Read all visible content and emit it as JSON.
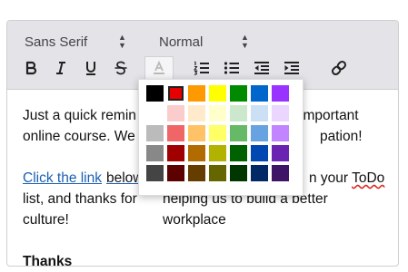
{
  "toolbar": {
    "font_value": "Sans Serif",
    "size_value": "Normal",
    "caret_up": "▲",
    "caret_down": "▼",
    "color_button_glyph": "A"
  },
  "icons": {
    "bold": "bold-icon",
    "italic": "italic-icon",
    "underline": "underline-icon",
    "strike": "strikethrough-icon",
    "text_color": "text-color-icon",
    "ordered_list": "ordered-list-icon",
    "bullet_list": "bullet-list-icon",
    "outdent": "outdent-icon",
    "indent": "indent-icon",
    "link": "link-icon"
  },
  "content": {
    "p1_a": "Just a quick remin",
    "p1_b": " important",
    "p1_c": "online course. We",
    "p1_d": "pation!",
    "p2_link": "Click the link",
    "p2_a": " below",
    "p2_b": "n your ",
    "p2_todo": "ToDo",
    "p2_c": "list, and thanks for",
    "p2_d": "helping us to build a better workplace",
    "p2_e": "culture!",
    "p3": "Thanks"
  },
  "palette": {
    "rows": [
      [
        "#000000",
        "#e60000",
        "#ff9900",
        "#ffff00",
        "#008a00",
        "#0066cc",
        "#9933ff"
      ],
      [
        "#ffffff",
        "#facccc",
        "#ffebcc",
        "#ffffcc",
        "#cce8cc",
        "#cce0f5",
        "#ebd6ff"
      ],
      [
        "#bbbbbb",
        "#f06666",
        "#ffc266",
        "#ffff66",
        "#66b966",
        "#66a3e0",
        "#c285ff"
      ],
      [
        "#888888",
        "#a10000",
        "#b26b00",
        "#b2b200",
        "#006100",
        "#0047b2",
        "#6b24b2"
      ],
      [
        "#444444",
        "#5c0000",
        "#663d00",
        "#666600",
        "#003700",
        "#002966",
        "#3d1466"
      ]
    ],
    "selected": "#e60000"
  },
  "colors": {
    "toolbar_bg": "#e3e3e8",
    "link": "#1a5fb4",
    "icon": "#222222"
  }
}
